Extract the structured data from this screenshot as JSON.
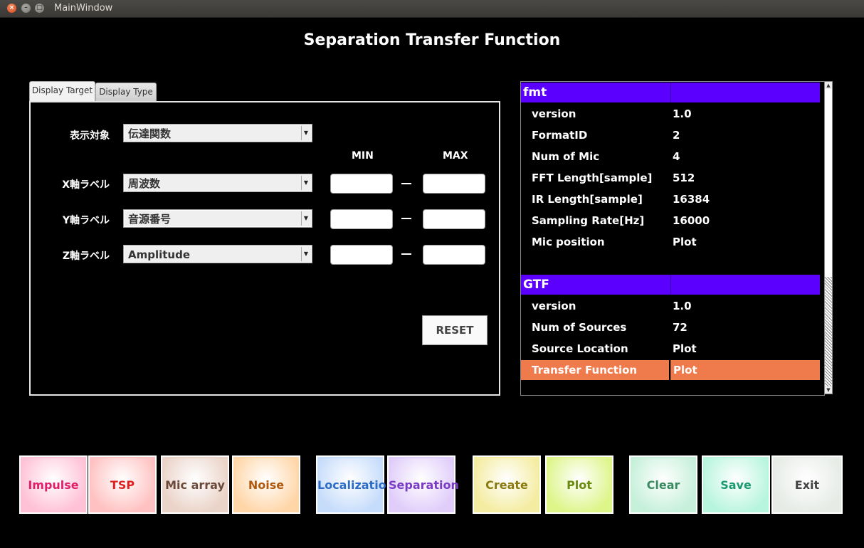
{
  "window": {
    "title": "MainWindow"
  },
  "page_title": "Separation Transfer Function",
  "tabs": [
    {
      "label": "Display Target",
      "active": true
    },
    {
      "label": "Display Type",
      "active": false
    }
  ],
  "form": {
    "target_label": "表示対象",
    "target_value": "伝達関数",
    "min_header": "MIN",
    "max_header": "MAX",
    "rows": [
      {
        "label": "X軸ラベル",
        "value": "周波数",
        "min": "",
        "max": ""
      },
      {
        "label": "Y軸ラベル",
        "value": "音源番号",
        "min": "",
        "max": ""
      },
      {
        "label": "Z軸ラベル",
        "value": "Amplitude",
        "min": "",
        "max": ""
      }
    ],
    "reset_label": "RESET"
  },
  "info_table": {
    "sections": [
      {
        "name": "fmt",
        "rows": [
          {
            "key": "version",
            "value": "1.0"
          },
          {
            "key": "FormatID",
            "value": "2"
          },
          {
            "key": "Num of Mic",
            "value": "4"
          },
          {
            "key": "FFT Length[sample]",
            "value": "512"
          },
          {
            "key": "IR Length[sample]",
            "value": "16384"
          },
          {
            "key": "Sampling Rate[Hz]",
            "value": "16000"
          },
          {
            "key": "Mic position",
            "value": "Plot"
          }
        ]
      },
      {
        "name": "GTF",
        "rows": [
          {
            "key": "version",
            "value": "1.0"
          },
          {
            "key": "Num of Sources",
            "value": "72"
          },
          {
            "key": "Source Location",
            "value": "Plot"
          },
          {
            "key": "Transfer Function",
            "value": "Plot",
            "selected": true
          }
        ]
      }
    ]
  },
  "buttons": [
    {
      "label": "Impulse",
      "color": "#e0206a",
      "bg": "#ffc1d6"
    },
    {
      "label": "TSP",
      "color": "#e0201e",
      "bg": "#ffc1c1"
    },
    {
      "label": "Mic array",
      "color": "#6b4a3a",
      "bg": "#ead3c8"
    },
    {
      "label": "Noise",
      "color": "#b05a10",
      "bg": "#ffd6a8"
    },
    {
      "label": "Localization",
      "color": "#2b6cc4",
      "bg": "#c6dcfb"
    },
    {
      "label": "Separation",
      "color": "#7a3cc4",
      "bg": "#e0cdfa"
    },
    {
      "label": "Create",
      "color": "#8a7a10",
      "bg": "#f4eca0"
    },
    {
      "label": "Plot",
      "color": "#6a8a10",
      "bg": "#def58a"
    },
    {
      "label": "Clear",
      "color": "#3a8a60",
      "bg": "#c6f0da"
    },
    {
      "label": "Save",
      "color": "#1a9a70",
      "bg": "#b8f5de"
    },
    {
      "label": "Exit",
      "color": "#444444",
      "bg": "#e6ebe6"
    }
  ]
}
